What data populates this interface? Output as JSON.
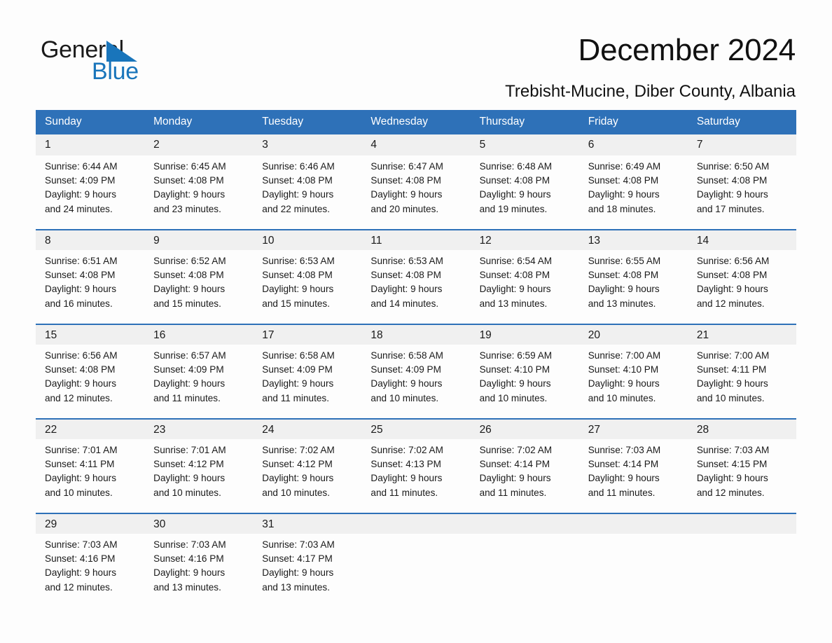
{
  "brand": {
    "name_part1": "General",
    "name_part2": "Blue",
    "accent_color": "#1975bb",
    "triangle_icon": "blue-triangle-icon"
  },
  "header": {
    "title": "December 2024",
    "subtitle": "Trebisht-Mucine, Diber County, Albania"
  },
  "theme": {
    "header_blue": "#2e71b8",
    "daynum_gray": "#f0f0f0",
    "text": "#1a1a1a"
  },
  "weekdays": [
    "Sunday",
    "Monday",
    "Tuesday",
    "Wednesday",
    "Thursday",
    "Friday",
    "Saturday"
  ],
  "weeks": [
    [
      {
        "day": "1",
        "sunrise": "Sunrise: 6:44 AM",
        "sunset": "Sunset: 4:09 PM",
        "daylight1": "Daylight: 9 hours",
        "daylight2": "and 24 minutes."
      },
      {
        "day": "2",
        "sunrise": "Sunrise: 6:45 AM",
        "sunset": "Sunset: 4:08 PM",
        "daylight1": "Daylight: 9 hours",
        "daylight2": "and 23 minutes."
      },
      {
        "day": "3",
        "sunrise": "Sunrise: 6:46 AM",
        "sunset": "Sunset: 4:08 PM",
        "daylight1": "Daylight: 9 hours",
        "daylight2": "and 22 minutes."
      },
      {
        "day": "4",
        "sunrise": "Sunrise: 6:47 AM",
        "sunset": "Sunset: 4:08 PM",
        "daylight1": "Daylight: 9 hours",
        "daylight2": "and 20 minutes."
      },
      {
        "day": "5",
        "sunrise": "Sunrise: 6:48 AM",
        "sunset": "Sunset: 4:08 PM",
        "daylight1": "Daylight: 9 hours",
        "daylight2": "and 19 minutes."
      },
      {
        "day": "6",
        "sunrise": "Sunrise: 6:49 AM",
        "sunset": "Sunset: 4:08 PM",
        "daylight1": "Daylight: 9 hours",
        "daylight2": "and 18 minutes."
      },
      {
        "day": "7",
        "sunrise": "Sunrise: 6:50 AM",
        "sunset": "Sunset: 4:08 PM",
        "daylight1": "Daylight: 9 hours",
        "daylight2": "and 17 minutes."
      }
    ],
    [
      {
        "day": "8",
        "sunrise": "Sunrise: 6:51 AM",
        "sunset": "Sunset: 4:08 PM",
        "daylight1": "Daylight: 9 hours",
        "daylight2": "and 16 minutes."
      },
      {
        "day": "9",
        "sunrise": "Sunrise: 6:52 AM",
        "sunset": "Sunset: 4:08 PM",
        "daylight1": "Daylight: 9 hours",
        "daylight2": "and 15 minutes."
      },
      {
        "day": "10",
        "sunrise": "Sunrise: 6:53 AM",
        "sunset": "Sunset: 4:08 PM",
        "daylight1": "Daylight: 9 hours",
        "daylight2": "and 15 minutes."
      },
      {
        "day": "11",
        "sunrise": "Sunrise: 6:53 AM",
        "sunset": "Sunset: 4:08 PM",
        "daylight1": "Daylight: 9 hours",
        "daylight2": "and 14 minutes."
      },
      {
        "day": "12",
        "sunrise": "Sunrise: 6:54 AM",
        "sunset": "Sunset: 4:08 PM",
        "daylight1": "Daylight: 9 hours",
        "daylight2": "and 13 minutes."
      },
      {
        "day": "13",
        "sunrise": "Sunrise: 6:55 AM",
        "sunset": "Sunset: 4:08 PM",
        "daylight1": "Daylight: 9 hours",
        "daylight2": "and 13 minutes."
      },
      {
        "day": "14",
        "sunrise": "Sunrise: 6:56 AM",
        "sunset": "Sunset: 4:08 PM",
        "daylight1": "Daylight: 9 hours",
        "daylight2": "and 12 minutes."
      }
    ],
    [
      {
        "day": "15",
        "sunrise": "Sunrise: 6:56 AM",
        "sunset": "Sunset: 4:08 PM",
        "daylight1": "Daylight: 9 hours",
        "daylight2": "and 12 minutes."
      },
      {
        "day": "16",
        "sunrise": "Sunrise: 6:57 AM",
        "sunset": "Sunset: 4:09 PM",
        "daylight1": "Daylight: 9 hours",
        "daylight2": "and 11 minutes."
      },
      {
        "day": "17",
        "sunrise": "Sunrise: 6:58 AM",
        "sunset": "Sunset: 4:09 PM",
        "daylight1": "Daylight: 9 hours",
        "daylight2": "and 11 minutes."
      },
      {
        "day": "18",
        "sunrise": "Sunrise: 6:58 AM",
        "sunset": "Sunset: 4:09 PM",
        "daylight1": "Daylight: 9 hours",
        "daylight2": "and 10 minutes."
      },
      {
        "day": "19",
        "sunrise": "Sunrise: 6:59 AM",
        "sunset": "Sunset: 4:10 PM",
        "daylight1": "Daylight: 9 hours",
        "daylight2": "and 10 minutes."
      },
      {
        "day": "20",
        "sunrise": "Sunrise: 7:00 AM",
        "sunset": "Sunset: 4:10 PM",
        "daylight1": "Daylight: 9 hours",
        "daylight2": "and 10 minutes."
      },
      {
        "day": "21",
        "sunrise": "Sunrise: 7:00 AM",
        "sunset": "Sunset: 4:11 PM",
        "daylight1": "Daylight: 9 hours",
        "daylight2": "and 10 minutes."
      }
    ],
    [
      {
        "day": "22",
        "sunrise": "Sunrise: 7:01 AM",
        "sunset": "Sunset: 4:11 PM",
        "daylight1": "Daylight: 9 hours",
        "daylight2": "and 10 minutes."
      },
      {
        "day": "23",
        "sunrise": "Sunrise: 7:01 AM",
        "sunset": "Sunset: 4:12 PM",
        "daylight1": "Daylight: 9 hours",
        "daylight2": "and 10 minutes."
      },
      {
        "day": "24",
        "sunrise": "Sunrise: 7:02 AM",
        "sunset": "Sunset: 4:12 PM",
        "daylight1": "Daylight: 9 hours",
        "daylight2": "and 10 minutes."
      },
      {
        "day": "25",
        "sunrise": "Sunrise: 7:02 AM",
        "sunset": "Sunset: 4:13 PM",
        "daylight1": "Daylight: 9 hours",
        "daylight2": "and 11 minutes."
      },
      {
        "day": "26",
        "sunrise": "Sunrise: 7:02 AM",
        "sunset": "Sunset: 4:14 PM",
        "daylight1": "Daylight: 9 hours",
        "daylight2": "and 11 minutes."
      },
      {
        "day": "27",
        "sunrise": "Sunrise: 7:03 AM",
        "sunset": "Sunset: 4:14 PM",
        "daylight1": "Daylight: 9 hours",
        "daylight2": "and 11 minutes."
      },
      {
        "day": "28",
        "sunrise": "Sunrise: 7:03 AM",
        "sunset": "Sunset: 4:15 PM",
        "daylight1": "Daylight: 9 hours",
        "daylight2": "and 12 minutes."
      }
    ],
    [
      {
        "day": "29",
        "sunrise": "Sunrise: 7:03 AM",
        "sunset": "Sunset: 4:16 PM",
        "daylight1": "Daylight: 9 hours",
        "daylight2": "and 12 minutes."
      },
      {
        "day": "30",
        "sunrise": "Sunrise: 7:03 AM",
        "sunset": "Sunset: 4:16 PM",
        "daylight1": "Daylight: 9 hours",
        "daylight2": "and 13 minutes."
      },
      {
        "day": "31",
        "sunrise": "Sunrise: 7:03 AM",
        "sunset": "Sunset: 4:17 PM",
        "daylight1": "Daylight: 9 hours",
        "daylight2": "and 13 minutes."
      },
      {
        "day": "",
        "sunrise": "",
        "sunset": "",
        "daylight1": "",
        "daylight2": ""
      },
      {
        "day": "",
        "sunrise": "",
        "sunset": "",
        "daylight1": "",
        "daylight2": ""
      },
      {
        "day": "",
        "sunrise": "",
        "sunset": "",
        "daylight1": "",
        "daylight2": ""
      },
      {
        "day": "",
        "sunrise": "",
        "sunset": "",
        "daylight1": "",
        "daylight2": ""
      }
    ]
  ]
}
